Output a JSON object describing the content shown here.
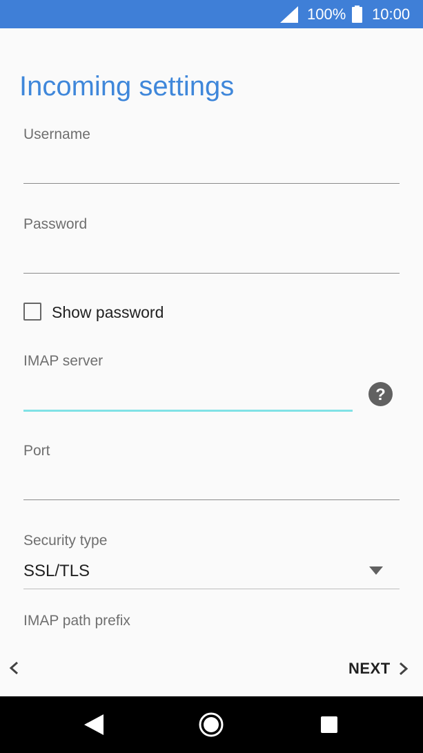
{
  "status_bar": {
    "battery_percent": "100%",
    "time": "10:00",
    "icons": [
      "signal-icon",
      "battery-icon"
    ]
  },
  "page": {
    "title": "Incoming settings"
  },
  "form": {
    "username": {
      "label": "Username",
      "value": ""
    },
    "password": {
      "label": "Password",
      "value": ""
    },
    "show_password": {
      "label": "Show password",
      "checked": false
    },
    "imap_server": {
      "label": "IMAP server",
      "value": "",
      "focused": true
    },
    "port": {
      "label": "Port",
      "value": ""
    },
    "security_type": {
      "label": "Security type",
      "value": "SSL/TLS"
    },
    "imap_path_prefix": {
      "label": "IMAP path prefix"
    }
  },
  "footer": {
    "next_label": "NEXT"
  },
  "colors": {
    "status_bar": "#3f7fd7",
    "title": "#3f87da",
    "focus_underline": "#80e2e6",
    "nav_bar": "#000000"
  }
}
